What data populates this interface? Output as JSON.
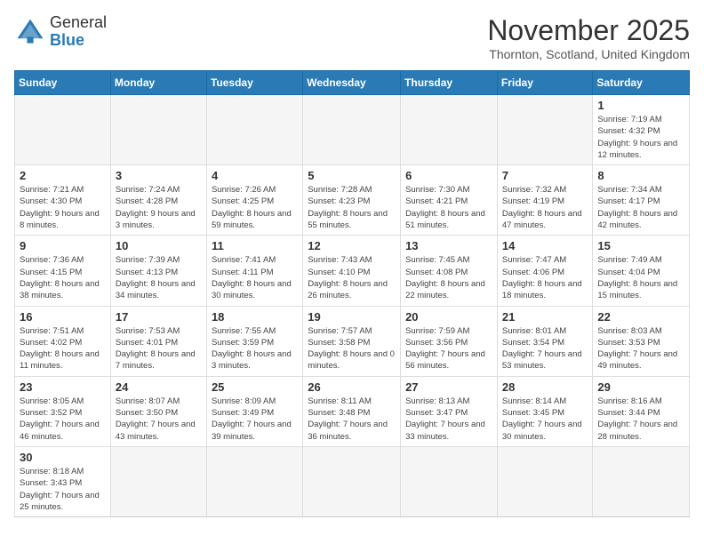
{
  "header": {
    "logo_general": "General",
    "logo_blue": "Blue",
    "month_title": "November 2025",
    "location": "Thornton, Scotland, United Kingdom"
  },
  "weekdays": [
    "Sunday",
    "Monday",
    "Tuesday",
    "Wednesday",
    "Thursday",
    "Friday",
    "Saturday"
  ],
  "weeks": [
    [
      {
        "day": "",
        "info": ""
      },
      {
        "day": "",
        "info": ""
      },
      {
        "day": "",
        "info": ""
      },
      {
        "day": "",
        "info": ""
      },
      {
        "day": "",
        "info": ""
      },
      {
        "day": "",
        "info": ""
      },
      {
        "day": "1",
        "info": "Sunrise: 7:19 AM\nSunset: 4:32 PM\nDaylight: 9 hours and 12 minutes."
      }
    ],
    [
      {
        "day": "2",
        "info": "Sunrise: 7:21 AM\nSunset: 4:30 PM\nDaylight: 9 hours and 8 minutes."
      },
      {
        "day": "3",
        "info": "Sunrise: 7:24 AM\nSunset: 4:28 PM\nDaylight: 9 hours and 3 minutes."
      },
      {
        "day": "4",
        "info": "Sunrise: 7:26 AM\nSunset: 4:25 PM\nDaylight: 8 hours and 59 minutes."
      },
      {
        "day": "5",
        "info": "Sunrise: 7:28 AM\nSunset: 4:23 PM\nDaylight: 8 hours and 55 minutes."
      },
      {
        "day": "6",
        "info": "Sunrise: 7:30 AM\nSunset: 4:21 PM\nDaylight: 8 hours and 51 minutes."
      },
      {
        "day": "7",
        "info": "Sunrise: 7:32 AM\nSunset: 4:19 PM\nDaylight: 8 hours and 47 minutes."
      },
      {
        "day": "8",
        "info": "Sunrise: 7:34 AM\nSunset: 4:17 PM\nDaylight: 8 hours and 42 minutes."
      }
    ],
    [
      {
        "day": "9",
        "info": "Sunrise: 7:36 AM\nSunset: 4:15 PM\nDaylight: 8 hours and 38 minutes."
      },
      {
        "day": "10",
        "info": "Sunrise: 7:39 AM\nSunset: 4:13 PM\nDaylight: 8 hours and 34 minutes."
      },
      {
        "day": "11",
        "info": "Sunrise: 7:41 AM\nSunset: 4:11 PM\nDaylight: 8 hours and 30 minutes."
      },
      {
        "day": "12",
        "info": "Sunrise: 7:43 AM\nSunset: 4:10 PM\nDaylight: 8 hours and 26 minutes."
      },
      {
        "day": "13",
        "info": "Sunrise: 7:45 AM\nSunset: 4:08 PM\nDaylight: 8 hours and 22 minutes."
      },
      {
        "day": "14",
        "info": "Sunrise: 7:47 AM\nSunset: 4:06 PM\nDaylight: 8 hours and 18 minutes."
      },
      {
        "day": "15",
        "info": "Sunrise: 7:49 AM\nSunset: 4:04 PM\nDaylight: 8 hours and 15 minutes."
      }
    ],
    [
      {
        "day": "16",
        "info": "Sunrise: 7:51 AM\nSunset: 4:02 PM\nDaylight: 8 hours and 11 minutes."
      },
      {
        "day": "17",
        "info": "Sunrise: 7:53 AM\nSunset: 4:01 PM\nDaylight: 8 hours and 7 minutes."
      },
      {
        "day": "18",
        "info": "Sunrise: 7:55 AM\nSunset: 3:59 PM\nDaylight: 8 hours and 3 minutes."
      },
      {
        "day": "19",
        "info": "Sunrise: 7:57 AM\nSunset: 3:58 PM\nDaylight: 8 hours and 0 minutes."
      },
      {
        "day": "20",
        "info": "Sunrise: 7:59 AM\nSunset: 3:56 PM\nDaylight: 7 hours and 56 minutes."
      },
      {
        "day": "21",
        "info": "Sunrise: 8:01 AM\nSunset: 3:54 PM\nDaylight: 7 hours and 53 minutes."
      },
      {
        "day": "22",
        "info": "Sunrise: 8:03 AM\nSunset: 3:53 PM\nDaylight: 7 hours and 49 minutes."
      }
    ],
    [
      {
        "day": "23",
        "info": "Sunrise: 8:05 AM\nSunset: 3:52 PM\nDaylight: 7 hours and 46 minutes."
      },
      {
        "day": "24",
        "info": "Sunrise: 8:07 AM\nSunset: 3:50 PM\nDaylight: 7 hours and 43 minutes."
      },
      {
        "day": "25",
        "info": "Sunrise: 8:09 AM\nSunset: 3:49 PM\nDaylight: 7 hours and 39 minutes."
      },
      {
        "day": "26",
        "info": "Sunrise: 8:11 AM\nSunset: 3:48 PM\nDaylight: 7 hours and 36 minutes."
      },
      {
        "day": "27",
        "info": "Sunrise: 8:13 AM\nSunset: 3:47 PM\nDaylight: 7 hours and 33 minutes."
      },
      {
        "day": "28",
        "info": "Sunrise: 8:14 AM\nSunset: 3:45 PM\nDaylight: 7 hours and 30 minutes."
      },
      {
        "day": "29",
        "info": "Sunrise: 8:16 AM\nSunset: 3:44 PM\nDaylight: 7 hours and 28 minutes."
      }
    ],
    [
      {
        "day": "30",
        "info": "Sunrise: 8:18 AM\nSunset: 3:43 PM\nDaylight: 7 hours and 25 minutes."
      },
      {
        "day": "",
        "info": ""
      },
      {
        "day": "",
        "info": ""
      },
      {
        "day": "",
        "info": ""
      },
      {
        "day": "",
        "info": ""
      },
      {
        "day": "",
        "info": ""
      },
      {
        "day": "",
        "info": ""
      }
    ]
  ]
}
